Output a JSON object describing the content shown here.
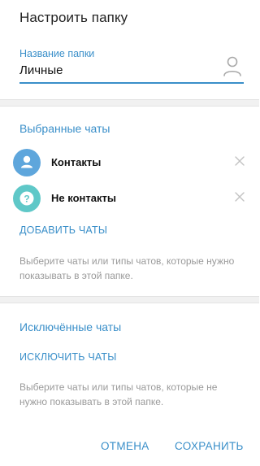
{
  "dialog": {
    "title": "Настроить папку"
  },
  "folder_name": {
    "label": "Название папки",
    "value": "Личные",
    "icon": "person-icon"
  },
  "included": {
    "title": "Выбранные чаты",
    "items": [
      {
        "label": "Контакты",
        "icon": "person-icon",
        "color": "#5ea6dc"
      },
      {
        "label": "Не контакты",
        "icon": "question-icon",
        "color": "#5fc8c8"
      }
    ],
    "add_label": "ДОБАВИТЬ ЧАТЫ",
    "hint": "Выберите чаты или типы чатов, которые нужно показывать в этой папке."
  },
  "excluded": {
    "title": "Исключённые чаты",
    "add_label": "ИСКЛЮЧИТЬ ЧАТЫ",
    "hint": "Выберите чаты или типы чатов, которые не нужно показывать в этой папке."
  },
  "footer": {
    "cancel_label": "ОТМЕНА",
    "save_label": "СОХРАНИТЬ"
  },
  "colors": {
    "accent": "#3a8fc9",
    "hint": "#9a9a9a",
    "separator": "#f1f1f1"
  }
}
